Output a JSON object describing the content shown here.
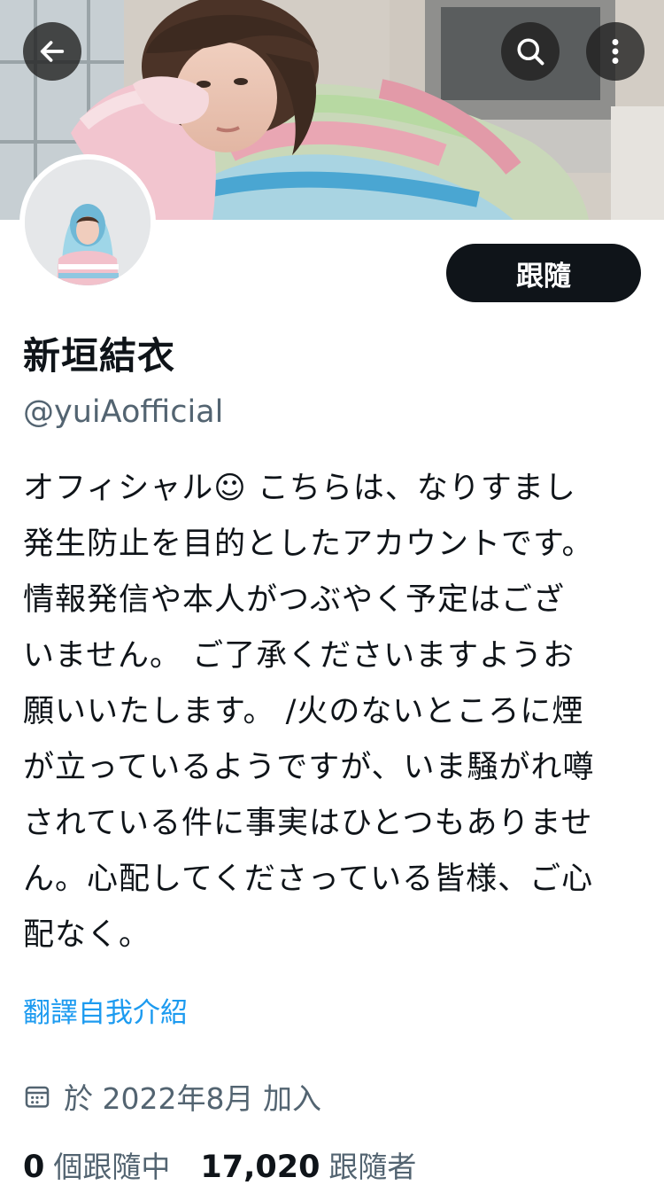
{
  "header": {
    "back_icon": "arrow-left-icon",
    "search_icon": "search-icon",
    "more_icon": "more-vertical-icon"
  },
  "profile": {
    "display_name": "新垣結衣",
    "handle": "@yuiAofficial",
    "follow_label": "跟隨",
    "bio_lines": [
      "オフィシャル☺ こちらは、なりすまし",
      "発生防止を目的としたアカウントです。",
      "情報発信や本人がつぶやく予定はござ",
      "いません。 ご了承くださいますようお",
      "願いいたします。 /火のないところに煙",
      "が立っているようですが、いま騒がれ噂",
      "されている件に事実はひとつもありませ",
      "ん。心配してくださっている皆様、ご心",
      "配なく。"
    ],
    "translate_label": "翻譯自我介紹",
    "joined_text": "於 2022年8月 加入",
    "following_count": "0",
    "following_label": "個跟隨中",
    "followers_count": "17,020",
    "followers_label": "跟隨者"
  },
  "colors": {
    "text_primary": "#0f1419",
    "text_secondary": "#536471",
    "link": "#1d9bf0",
    "button_bg": "#0f1419"
  }
}
